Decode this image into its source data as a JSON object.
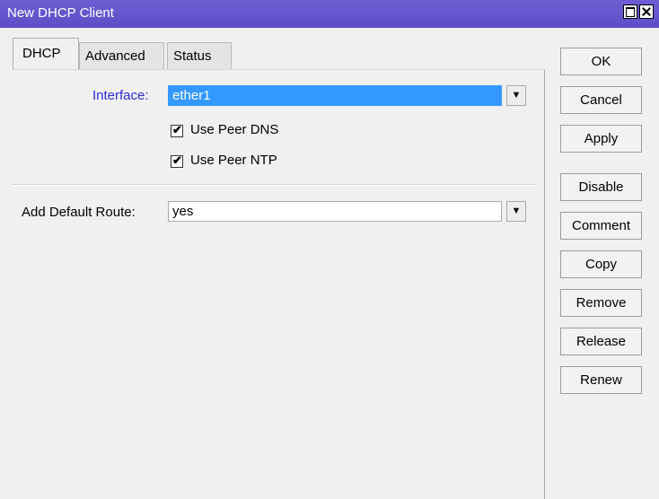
{
  "window": {
    "title": "New DHCP Client"
  },
  "tabs": [
    {
      "label": "DHCP"
    },
    {
      "label": "Advanced"
    },
    {
      "label": "Status"
    }
  ],
  "form": {
    "interface_label": "Interface:",
    "interface_value": "ether1",
    "use_peer_dns_label": "Use Peer DNS",
    "use_peer_dns_checked": true,
    "use_peer_ntp_label": "Use Peer NTP",
    "use_peer_ntp_checked": true,
    "add_default_route_label": "Add Default Route:",
    "add_default_route_value": "yes"
  },
  "buttons": [
    {
      "label": "OK"
    },
    {
      "label": "Cancel"
    },
    {
      "label": "Apply"
    },
    {
      "label": "Disable"
    },
    {
      "label": "Comment"
    },
    {
      "label": "Copy"
    },
    {
      "label": "Remove"
    },
    {
      "label": "Release"
    },
    {
      "label": "Renew"
    }
  ],
  "icons": {
    "dropdown": "dropdown-arrow-icon",
    "check": "✔"
  }
}
